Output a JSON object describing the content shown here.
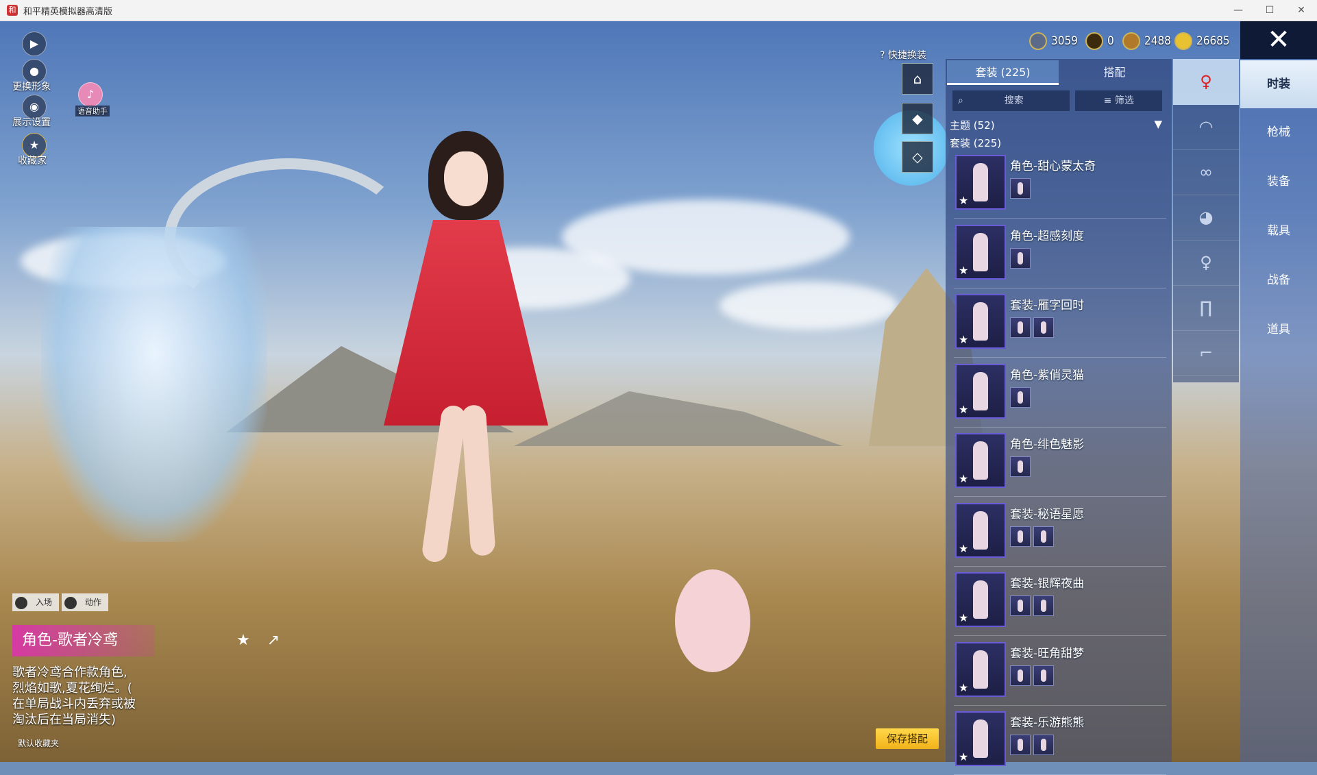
{
  "window": {
    "title": "和平精英模拟器高清版",
    "app_icon": "app-icon",
    "controls": [
      "—",
      "☐",
      "✕"
    ]
  },
  "currencies": [
    {
      "icon": "silver-coin-icon",
      "value": "3059"
    },
    {
      "icon": "gold-token-icon",
      "value": "0"
    },
    {
      "icon": "bronze-coin-icon",
      "value": "2488"
    },
    {
      "icon": "lightning-coin-icon",
      "value": "26685"
    }
  ],
  "left_menu": {
    "change_look": "更换形象",
    "display_settings": "展示设置",
    "collector": "收藏家",
    "voice_assistant": "语音助手"
  },
  "quick_change": {
    "label": "快捷换装"
  },
  "save_button": "保存搭配",
  "tabs": {
    "suits": "套装 (225)",
    "matching": "搭配"
  },
  "search": {
    "placeholder": "搜索",
    "filter": "筛选"
  },
  "theme": "主题 (52)",
  "suit_count": "套装 (225)",
  "items": [
    {
      "title": "角色-甜心蒙太奇",
      "extras": 1
    },
    {
      "title": "角色-超感刻度",
      "extras": 1
    },
    {
      "title": "套装-雁字回时",
      "extras": 2
    },
    {
      "title": "角色-紫俏灵猫",
      "extras": 1
    },
    {
      "title": "角色-绯色魅影",
      "extras": 1
    },
    {
      "title": "套装-秘语星愿",
      "extras": 2
    },
    {
      "title": "套装-银辉夜曲",
      "extras": 2
    },
    {
      "title": "套装-旺角甜梦",
      "extras": 2
    },
    {
      "title": "套装-乐游熊熊",
      "extras": 2
    }
  ],
  "categories": [
    "outfit-icon",
    "hat-icon",
    "glasses-icon",
    "mask-icon",
    "top-icon",
    "pants-icon",
    "shoes-icon"
  ],
  "right_nav": [
    "时装",
    "枪械",
    "装备",
    "载具",
    "战备",
    "道具"
  ],
  "actions": {
    "entrance": "入场",
    "motion": "动作"
  },
  "character": {
    "name": "角色-歌者冷鸢",
    "description_lines": [
      "歌者冷鸢合作款角色,",
      "烈焰如歌,夏花绚烂。(",
      "在单局战斗内丢弃或被",
      "淘汰后在当局消失)"
    ],
    "favorite_folder": "默认收藏夹"
  }
}
